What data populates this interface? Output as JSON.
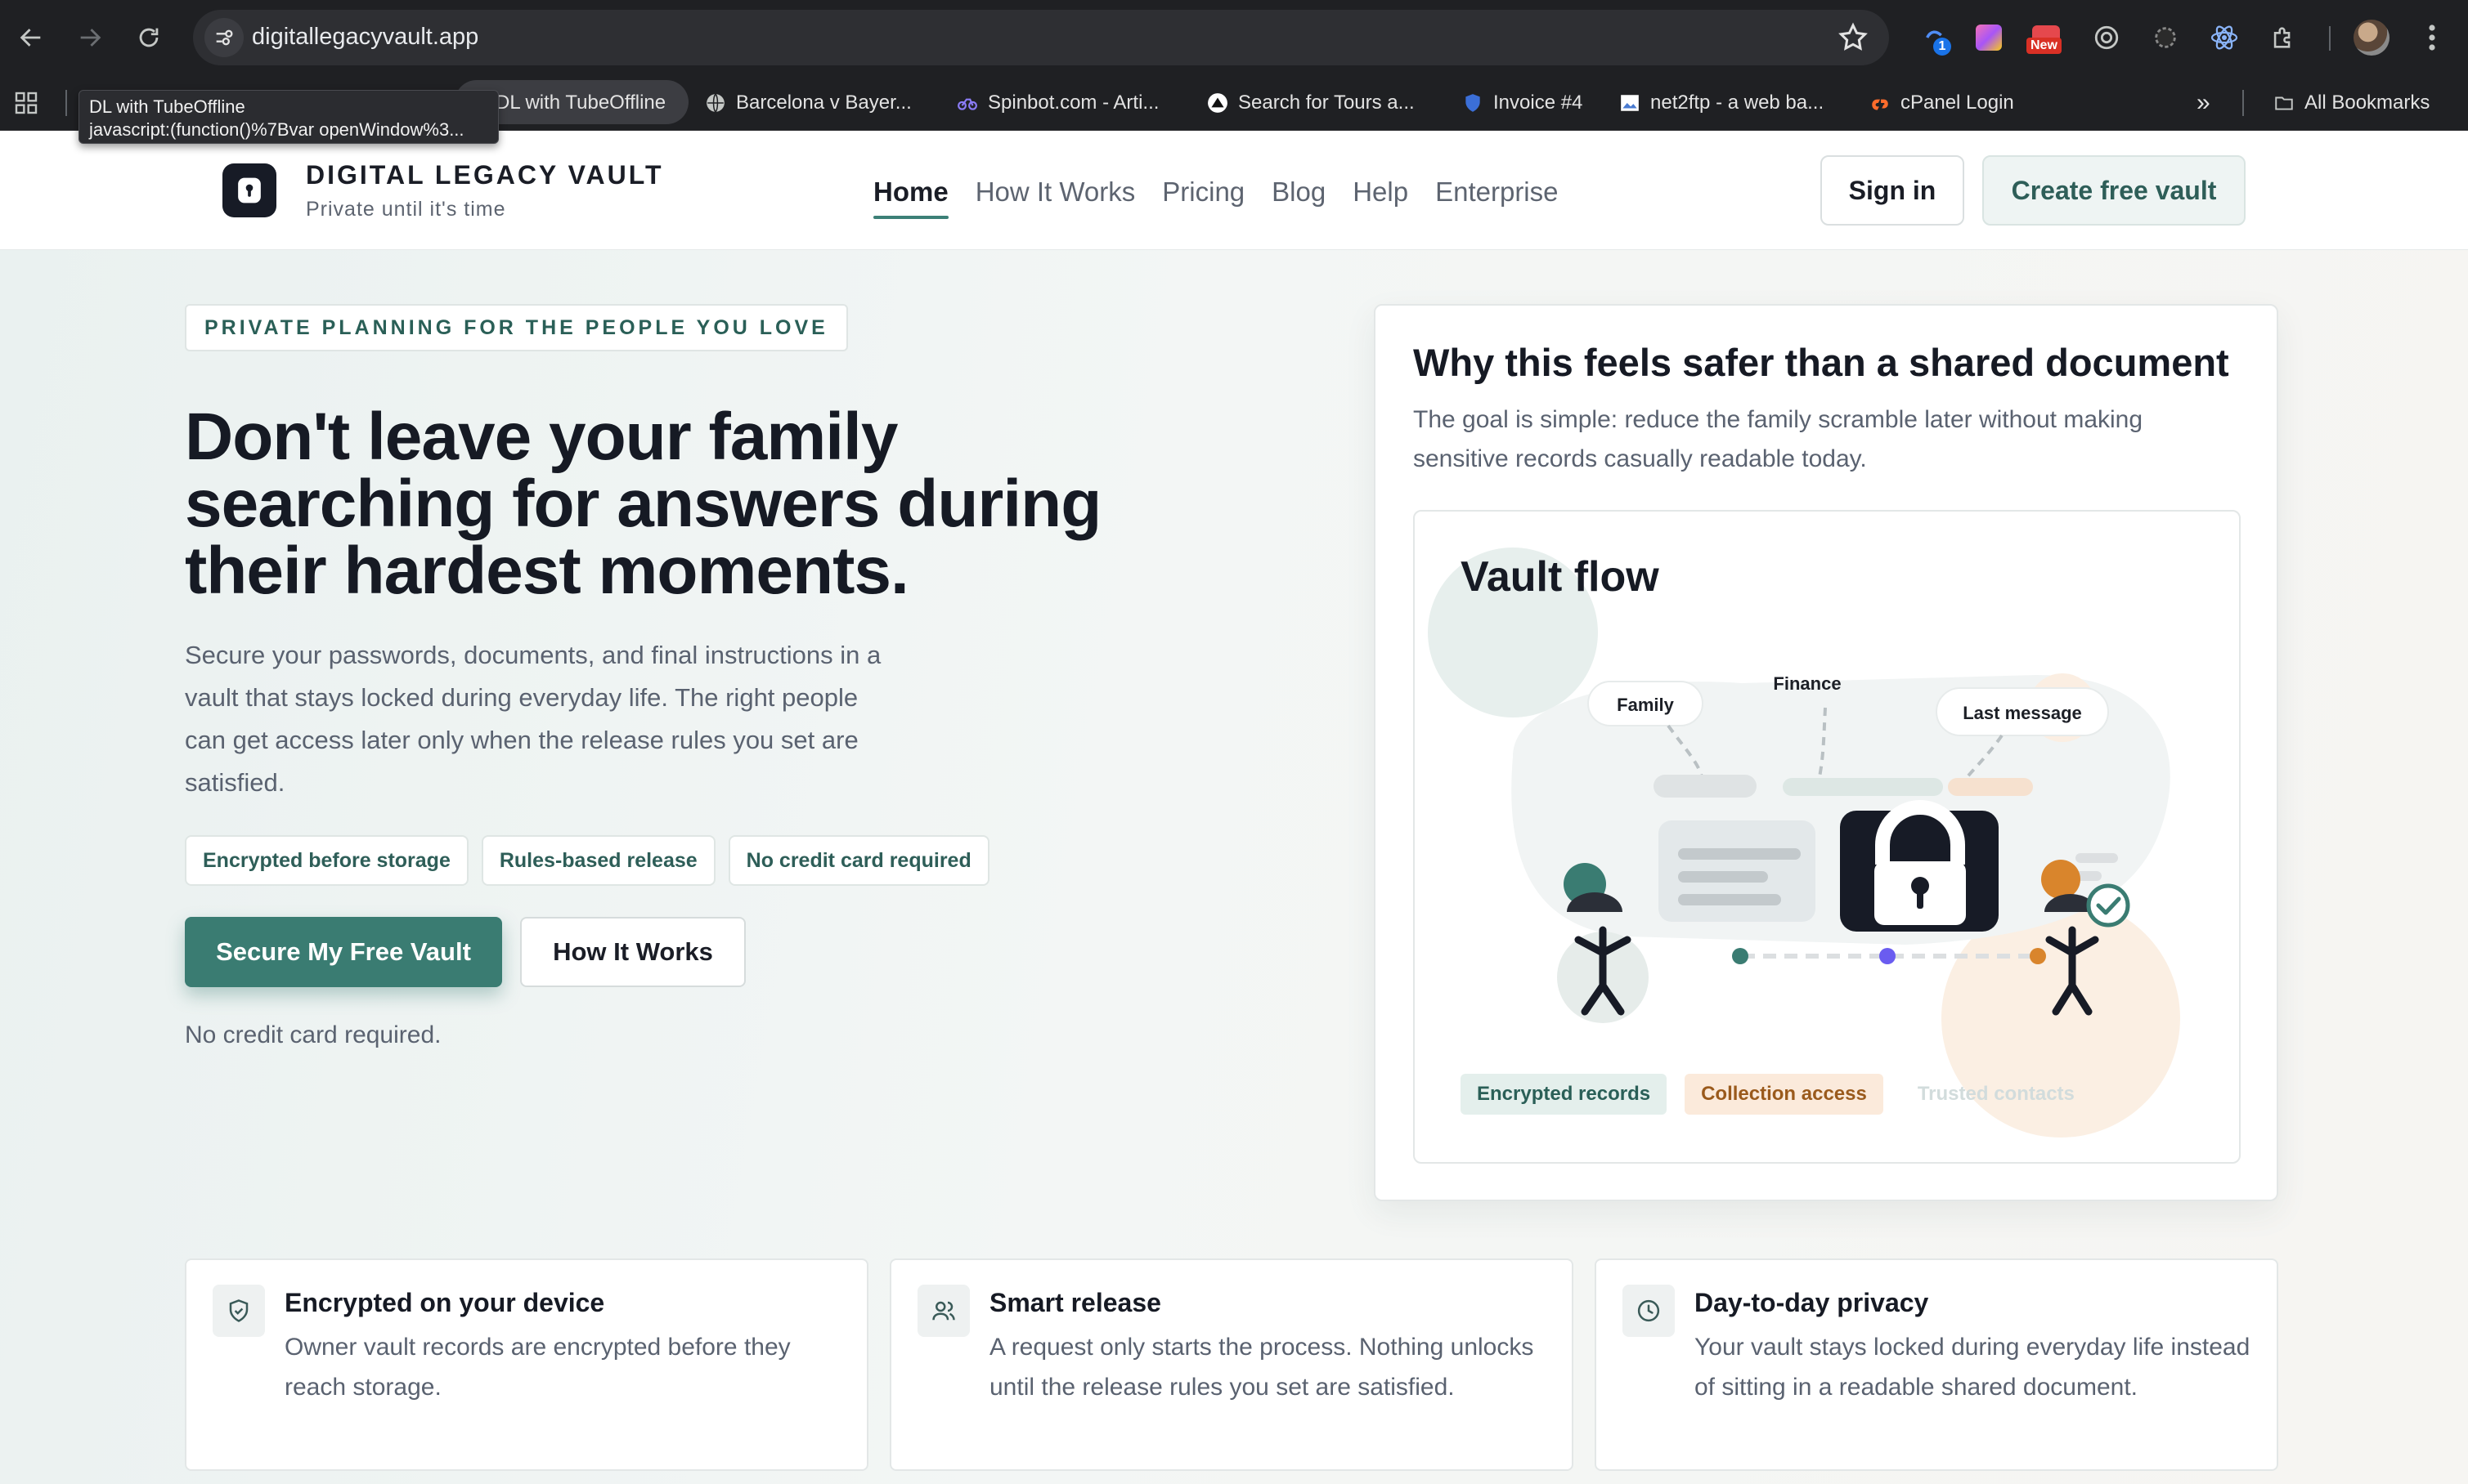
{
  "browser": {
    "url": "digitallegacyvault.app",
    "badge_new": "New",
    "badge_count": "1",
    "bookmarks": [
      {
        "label": "DL with TubeOffline"
      },
      {
        "label": "Barcelona v Bayer..."
      },
      {
        "label": "Spinbot.com - Arti..."
      },
      {
        "label": "Search for Tours a..."
      },
      {
        "label": "Invoice #4"
      },
      {
        "label": "net2ftp - a web ba..."
      },
      {
        "label": "cPanel Login"
      }
    ],
    "overflow_label": "»",
    "all_bookmarks": "All Bookmarks",
    "tooltip_title": "DL with TubeOffline",
    "tooltip_url": "javascript:(function()%7Bvar openWindow%3..."
  },
  "header": {
    "brand_name": "DIGITAL LEGACY VAULT",
    "brand_tagline": "Private until it's time",
    "nav": [
      "Home",
      "How It Works",
      "Pricing",
      "Blog",
      "Help",
      "Enterprise"
    ],
    "active_nav": "Home",
    "sign_in": "Sign in",
    "create_vault": "Create free vault"
  },
  "hero": {
    "eyebrow": "PRIVATE PLANNING FOR THE PEOPLE YOU LOVE",
    "title": "Don't leave your family searching for answers during their hardest moments.",
    "subtitle": "Secure your passwords, documents, and final instructions in a vault that stays locked during everyday life. The right people can get access later only when the release rules you set are satisfied.",
    "pills": [
      "Encrypted before storage",
      "Rules-based release",
      "No credit card required"
    ],
    "primary_cta": "Secure My Free Vault",
    "secondary_cta": "How It Works",
    "note": "No credit card required."
  },
  "why_card": {
    "title": "Why this feels safer than a shared document",
    "subtitle": "The goal is simple: reduce the family scramble later without making sensitive records casually readable today.",
    "flow_title": "Vault flow",
    "flow_labels": {
      "family": "Family",
      "finance": "Finance",
      "last_message": "Last message"
    },
    "chips": [
      "Encrypted records",
      "Collection access",
      "Trusted contacts"
    ],
    "colors": {
      "green": "#3a7c72",
      "orange": "#d9852c",
      "purple": "#6a5cf0",
      "dark": "#171b26"
    }
  },
  "features": [
    {
      "icon": "shield-check-icon",
      "title": "Encrypted on your device",
      "text": "Owner vault records are encrypted before they reach storage."
    },
    {
      "icon": "users-icon",
      "title": "Smart release",
      "text": "A request only starts the process. Nothing unlocks until the release rules you set are satisfied."
    },
    {
      "icon": "clock-icon",
      "title": "Day-to-day privacy",
      "text": "Your vault stays locked during everyday life instead of sitting in a readable shared document."
    }
  ]
}
